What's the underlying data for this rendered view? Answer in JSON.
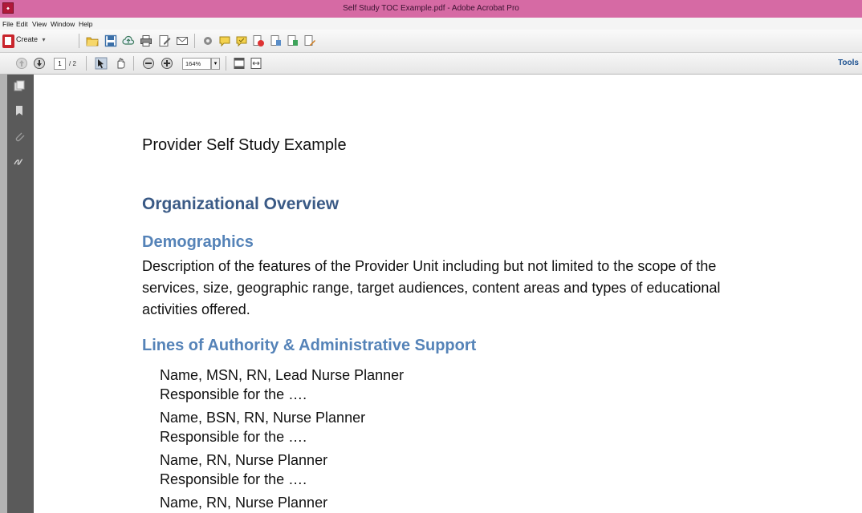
{
  "window": {
    "title": "Self Study TOC Example.pdf - Adobe Acrobat Pro"
  },
  "menu": [
    "File",
    "Edit",
    "View",
    "Window",
    "Help"
  ],
  "toolbar": {
    "create_label": "Create",
    "create_arrow": "▾"
  },
  "nav": {
    "page_current": "1",
    "page_total": "/ 2",
    "zoom": "164%",
    "zoom_arrow": "▾",
    "tools_label": "Tools"
  },
  "document": {
    "title": "Provider Self Study Example",
    "heading1": "Organizational Overview",
    "section_demographics": "Demographics",
    "demographics_text_lines": [
      "Description of the features of the Provider Unit including but not limited to the scope of the",
      "services, size, geographic range, target audiences, content areas and types of educational",
      "activities offered."
    ],
    "section_authority": "Lines of Authority & Administrative Support",
    "entries": [
      {
        "name": "Name, MSN, RN, Lead Nurse Planner",
        "role": "Responsible for the …."
      },
      {
        "name": "Name, BSN, RN, Nurse Planner",
        "role": "Responsible for the …."
      },
      {
        "name": "Name, RN, Nurse Planner",
        "role": "Responsible for the …."
      },
      {
        "name": "Name, RN, Nurse Planner",
        "role": ""
      }
    ]
  }
}
